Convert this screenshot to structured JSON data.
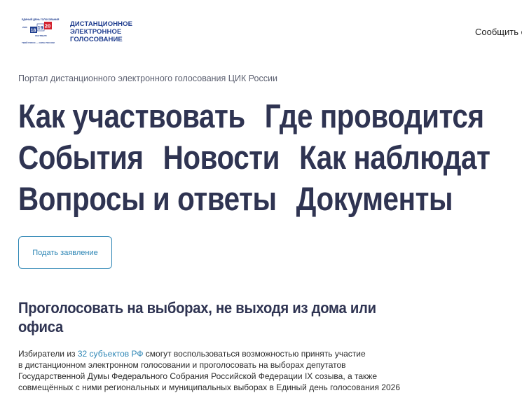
{
  "header": {
    "logo": {
      "top_line": "ЕДИНЫЙ ДЕНЬ ГОЛОСОВАНИЯ",
      "year": "2026",
      "day1": "18",
      "day2": "19",
      "day3": "20",
      "month": "СЕНТЯБРЯ",
      "slogan": "ТВОЙ ГОЛОС — СИЛА РОССИИ",
      "colors": {
        "blue": "#1f3d8f",
        "red": "#d3232f"
      }
    },
    "title_lines": [
      "ДИСТАНЦИОННОЕ",
      "ЭЛЕКТРОННОЕ",
      "ГОЛОСОВАНИЕ"
    ],
    "report_link": "Сообщить о"
  },
  "subtitle": "Портал дистанционного электронного голосования ЦИК России",
  "nav": {
    "row1": [
      "Как участвовать",
      "Где проводится"
    ],
    "row2": [
      "События",
      "Новости",
      "Как наблюдат"
    ],
    "row3": [
      "Вопросы и ответы",
      "Документы"
    ]
  },
  "apply_button": "Подать заявление",
  "section": {
    "title_lines": [
      "Проголосовать на выборах, не выходя из дома или",
      "офиса"
    ],
    "text": {
      "p1_before": "Избиратели из ",
      "p1_link": "32 субъектов РФ",
      "p1_after": " смогут воспользоваться возможностью принять участие",
      "line2": "в дистанционном электронном голосовании и проголосовать на выборах депутатов",
      "line3": "Государственной Думы Федерального Собрания Российской Федерации IX созыва, а также",
      "line4": "совмещённых с ними региональных и муниципальных выборах в Единый день голосования 2026"
    }
  },
  "colors": {
    "accent": "#2e86b5",
    "heading": "#2f3452",
    "muted": "#5c6070"
  }
}
